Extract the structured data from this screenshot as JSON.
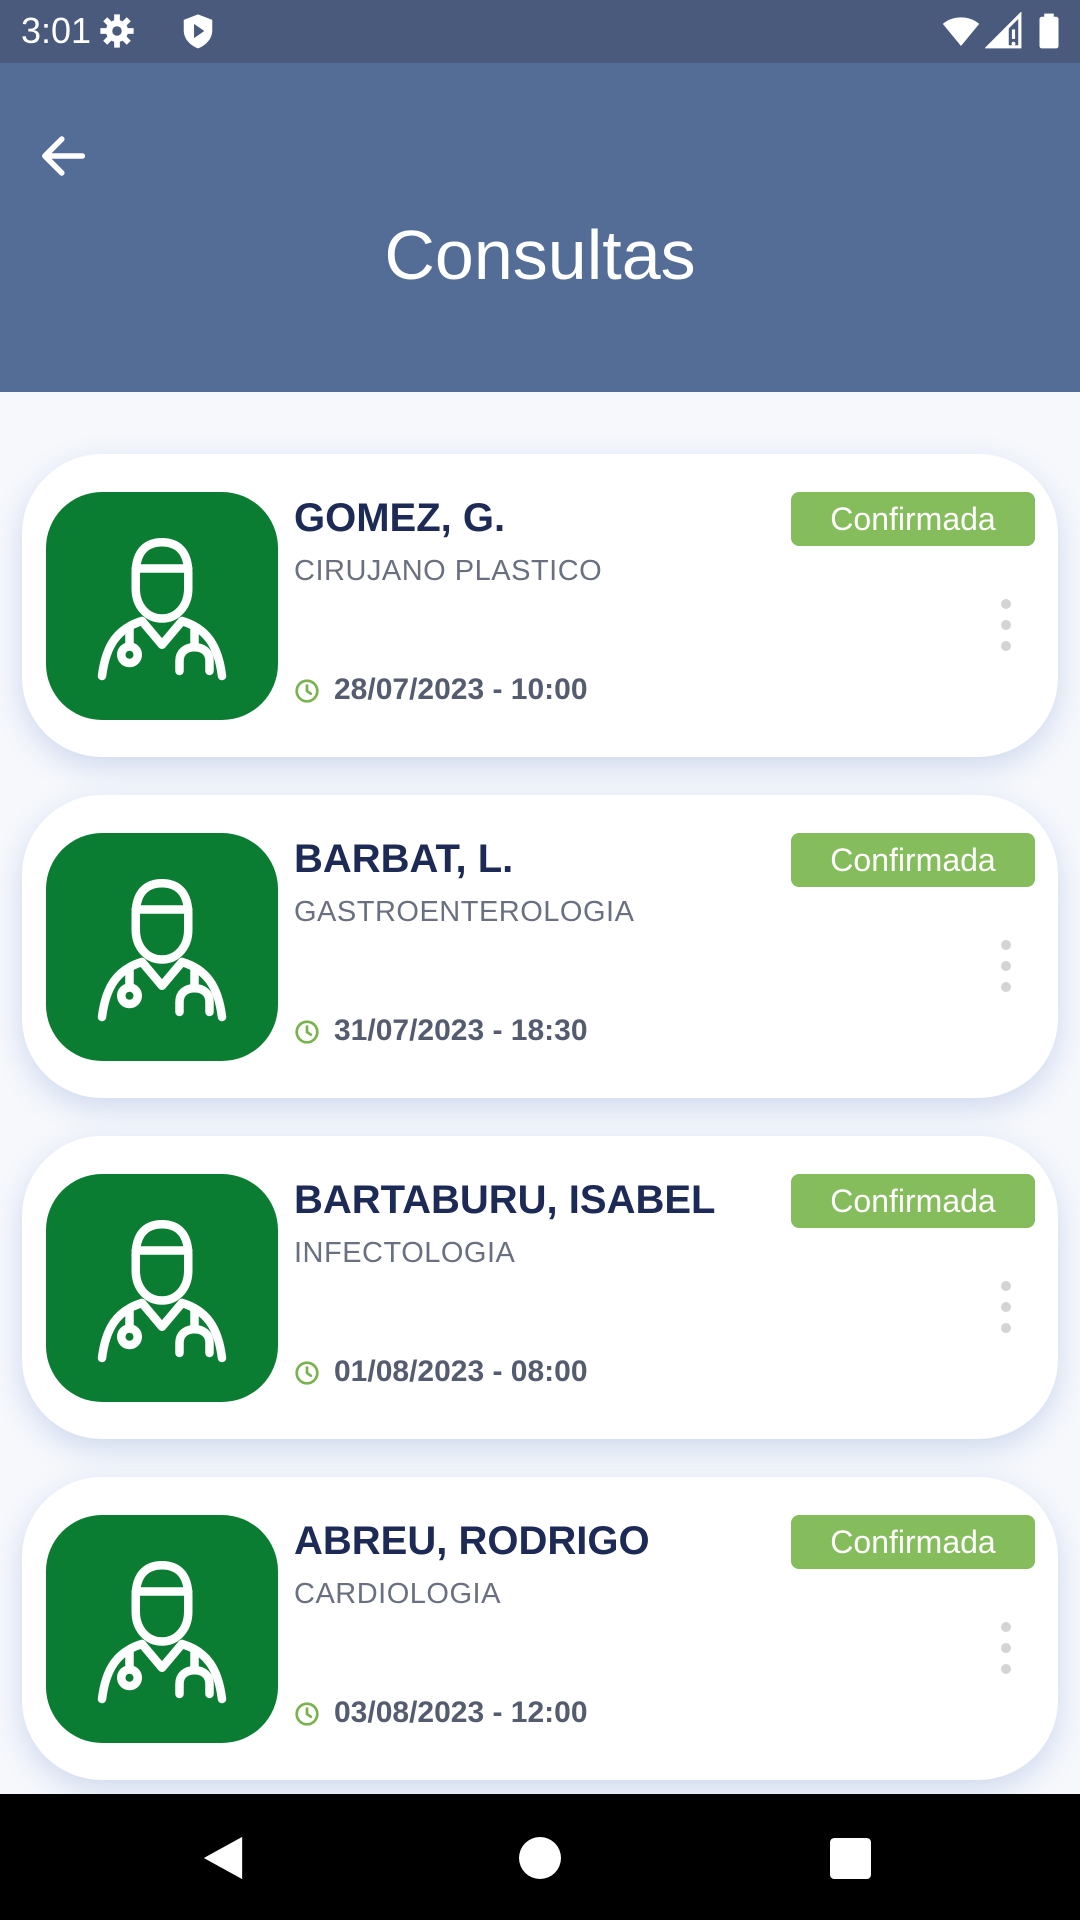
{
  "status_bar": {
    "time": "3:01"
  },
  "header": {
    "title": "Consultas"
  },
  "appointments": [
    {
      "doctor": "GOMEZ, G.",
      "specialty": "CIRUJANO PLASTICO",
      "status": "Confirmada",
      "datetime": "28/07/2023 - 10:00"
    },
    {
      "doctor": "BARBAT, L.",
      "specialty": "GASTROENTEROLOGIA",
      "status": "Confirmada",
      "datetime": "31/07/2023 - 18:30"
    },
    {
      "doctor": "BARTABURU, ISABEL",
      "specialty": "INFECTOLOGIA",
      "status": "Confirmada",
      "datetime": "01/08/2023 - 08:00"
    },
    {
      "doctor": "ABREU, RODRIGO",
      "specialty": "CARDIOLOGIA",
      "status": "Confirmada",
      "datetime": "03/08/2023 - 12:00"
    }
  ],
  "colors": {
    "app_bar": "#546d97",
    "status_bar": "#4a5a7d",
    "avatar_bg": "#0a7d33",
    "badge_bg": "#86bd5c",
    "clock_icon": "#7bb24f"
  },
  "icons": {
    "back": "arrow-left-icon",
    "avatar": "doctor-icon",
    "more": "more-vertical-icon",
    "clock": "clock-icon"
  }
}
